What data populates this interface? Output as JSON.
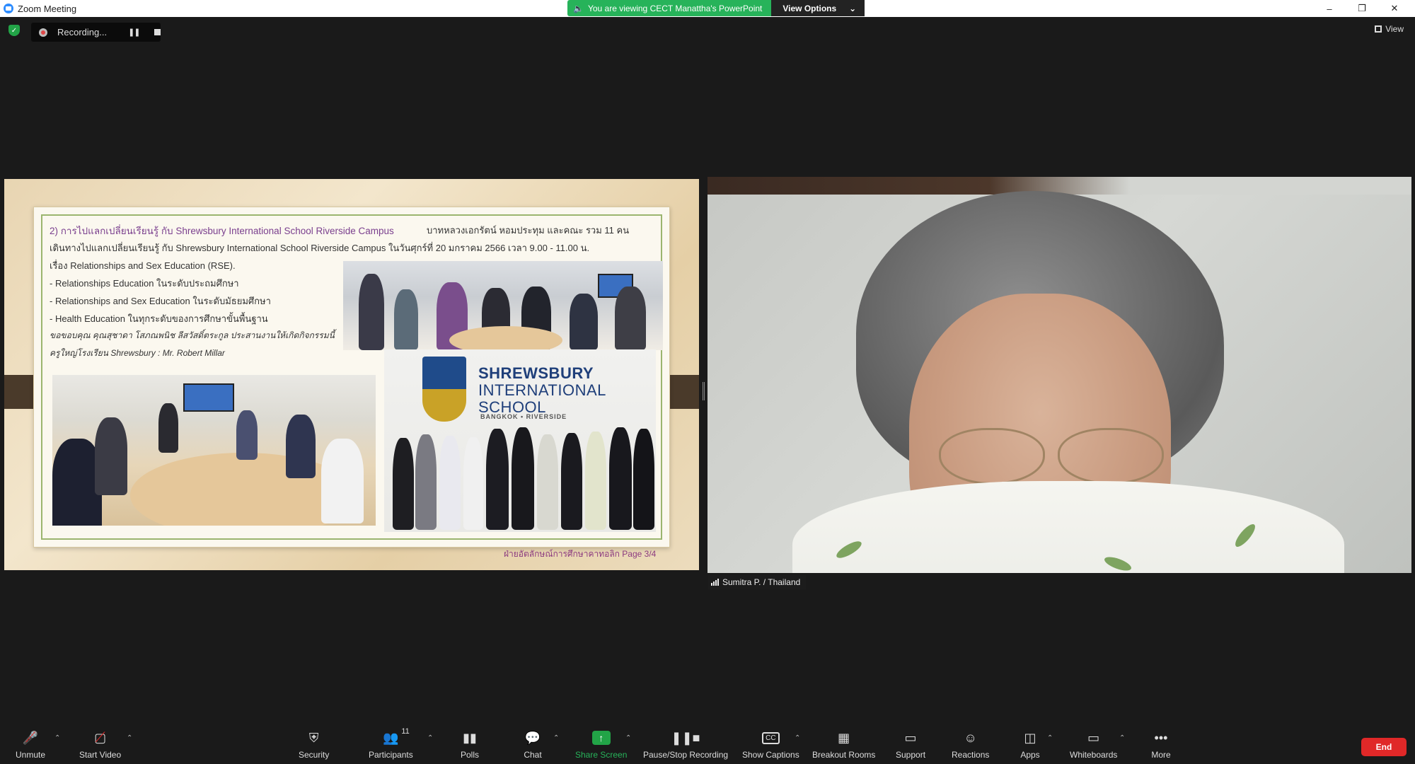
{
  "window": {
    "title": "Zoom Meeting",
    "share_banner": "You are viewing CECT Manattha's PowerPoint",
    "view_options": "View Options"
  },
  "meeting": {
    "recording_label": "Recording...",
    "view_label": "View"
  },
  "slide": {
    "title_line": "2) การไปแลกเปลี่ยนเรียนรู้ กับ Shrewsbury International School Riverside Campus",
    "title_right": "บาทหลวงเอกรัตน์ หอมประทุม และคณะ รวม 11 คน",
    "line2": "เดินทางไปแลกเปลี่ยนเรียนรู้ กับ Shrewsbury International School Riverside Campus ในวันศุกร์ที่ 20 มกราคม 2566 เวลา 9.00 - 11.00 น.",
    "line3": "เรื่อง     Relationships and Sex Education (RSE).",
    "line4": "- Relationships Education ในระดับประถมศึกษา",
    "line5": "- Relationships and Sex Education ในระดับมัธยมศึกษา",
    "line6": "- Health Education ในทุกระดับของการศึกษาขั้นพื้นฐาน",
    "line7": "ขอขอบคุณ คุณสุชาดา โสภณพนิช ลีสวัสดิ์ตระกูล ประสานงานให้เกิดกิจกรรมนี้",
    "line8": "ครูใหญ่โรงเรียน Shrewsbury : Mr. Robert Millar",
    "school_name_1": "SHREWSBURY",
    "school_name_2": "INTERNATIONAL",
    "school_name_3": "SCHOOL",
    "school_sub": "BANGKOK • RIVERSIDE",
    "footer": "ฝ่ายอัตลักษณ์การศึกษาคาทอลิก  Page 3/4"
  },
  "participant": {
    "name": "Sumitra P. / Thailand"
  },
  "toolbar": {
    "unmute": "Unmute",
    "start_video": "Start Video",
    "security": "Security",
    "participants": "Participants",
    "participants_count": "11",
    "polls": "Polls",
    "chat": "Chat",
    "share_screen": "Share Screen",
    "pause_stop_recording": "Pause/Stop Recording",
    "show_captions": "Show Captions",
    "breakout_rooms": "Breakout Rooms",
    "support": "Support",
    "reactions": "Reactions",
    "apps": "Apps",
    "whiteboards": "Whiteboards",
    "more": "More",
    "end": "End"
  },
  "colors": {
    "share_green": "#27b35a",
    "end_red": "#e02828",
    "slide_purple": "#7a3f8e"
  }
}
